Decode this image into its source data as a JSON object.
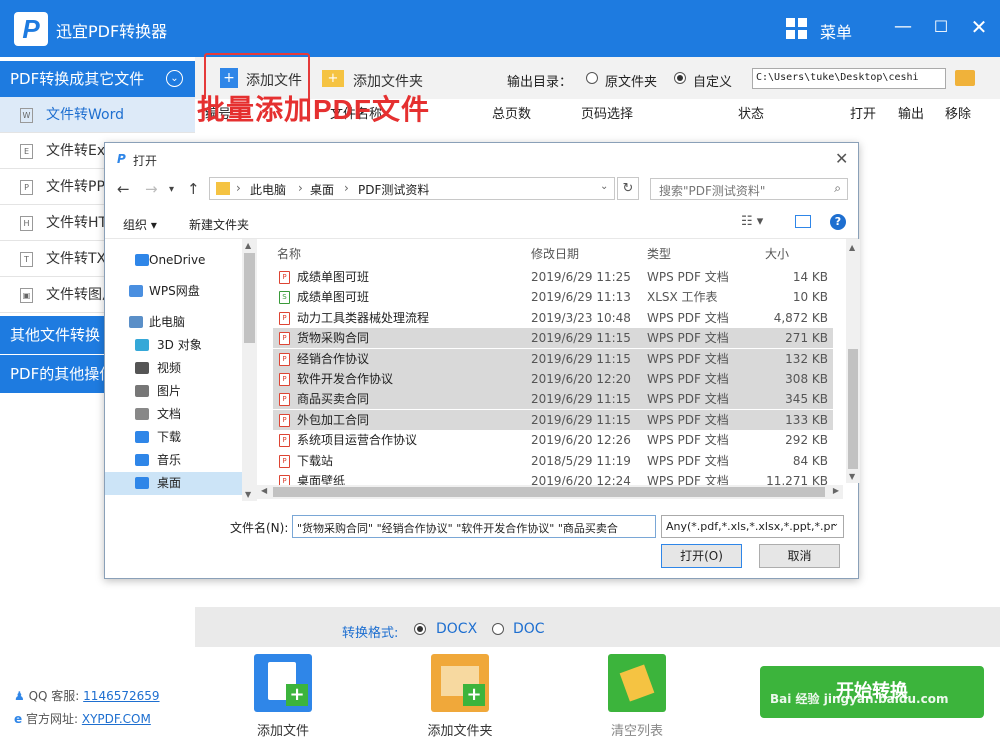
{
  "app": {
    "title": "迅宜PDF转换器",
    "logo_letter": "P",
    "menu_label": "菜单"
  },
  "sidebar": {
    "group1": "PDF转换成其它文件",
    "items": [
      {
        "label": "文件转Word",
        "icon": "W"
      },
      {
        "label": "文件转Exc",
        "icon": "E"
      },
      {
        "label": "文件转PP",
        "icon": "P"
      },
      {
        "label": "文件转HT",
        "icon": "H"
      },
      {
        "label": "文件转TX",
        "icon": "T"
      },
      {
        "label": "文件转图片",
        "icon": "img"
      }
    ],
    "group2": "其他文件转换",
    "group3": "PDF的其他操作"
  },
  "toolbar": {
    "add_file": "添加文件",
    "add_folder": "添加文件夹",
    "output_label": "输出目录：",
    "radio_source": "原文件夹",
    "radio_custom": "自定义",
    "output_path": "C:\\Users\\tuke\\Desktop\\ceshi"
  },
  "table_header": [
    "编号",
    "文件名称",
    "总页数",
    "页码选择",
    "状态",
    "打开",
    "输出",
    "移除"
  ],
  "dialog": {
    "title": "打开",
    "breadcrumb": [
      "此电脑",
      "桌面",
      "PDF测试资料"
    ],
    "search_placeholder": "搜索\"PDF测试资料\"",
    "organize": "组织 ▾",
    "new_folder": "新建文件夹",
    "nav": [
      {
        "label": "OneDrive",
        "color": "#2f86e8"
      },
      {
        "label": "WPS网盘",
        "color": "#4a8fe0"
      },
      {
        "label": "此电脑",
        "color": "#5a8fc8"
      },
      {
        "label": "3D 对象",
        "color": "#35a8d8"
      },
      {
        "label": "视频",
        "color": "#555555"
      },
      {
        "label": "图片",
        "color": "#777777"
      },
      {
        "label": "文档",
        "color": "#888888"
      },
      {
        "label": "下载",
        "color": "#2f86e8"
      },
      {
        "label": "音乐",
        "color": "#2f86e8"
      },
      {
        "label": "桌面",
        "color": "#2f86e8"
      }
    ],
    "columns": [
      "名称",
      "修改日期",
      "类型",
      "大小"
    ],
    "files": [
      {
        "name": "成绩单图可班",
        "date": "2019/6/29 11:25",
        "type": "WPS PDF 文档",
        "size": "14 KB",
        "sel": false,
        "kind": "pdf"
      },
      {
        "name": "成绩单图可班",
        "date": "2019/6/29 11:13",
        "type": "XLSX 工作表",
        "size": "10 KB",
        "sel": false,
        "kind": "xlsx"
      },
      {
        "name": "动力工具类器械处理流程",
        "date": "2019/3/23 10:48",
        "type": "WPS PDF 文档",
        "size": "4,872 KB",
        "sel": false,
        "kind": "pdf"
      },
      {
        "name": "货物采购合同",
        "date": "2019/6/29 11:15",
        "type": "WPS PDF 文档",
        "size": "271 KB",
        "sel": true,
        "kind": "pdf"
      },
      {
        "name": "经销合作协议",
        "date": "2019/6/29 11:15",
        "type": "WPS PDF 文档",
        "size": "132 KB",
        "sel": true,
        "kind": "pdf"
      },
      {
        "name": "软件开发合作协议",
        "date": "2019/6/20 12:20",
        "type": "WPS PDF 文档",
        "size": "308 KB",
        "sel": true,
        "kind": "pdf"
      },
      {
        "name": "商品买卖合同",
        "date": "2019/6/29 11:15",
        "type": "WPS PDF 文档",
        "size": "345 KB",
        "sel": true,
        "kind": "pdf"
      },
      {
        "name": "外包加工合同",
        "date": "2019/6/29 11:15",
        "type": "WPS PDF 文档",
        "size": "133 KB",
        "sel": true,
        "kind": "pdf"
      },
      {
        "name": "系统项目运营合作协议",
        "date": "2019/6/20 12:26",
        "type": "WPS PDF 文档",
        "size": "292 KB",
        "sel": false,
        "kind": "pdf"
      },
      {
        "name": "下载站",
        "date": "2018/5/29 11:19",
        "type": "WPS PDF 文档",
        "size": "84 KB",
        "sel": false,
        "kind": "pdf"
      },
      {
        "name": "桌面壁纸",
        "date": "2019/6/20 12:24",
        "type": "WPS PDF 文档",
        "size": "11,271 KB",
        "sel": false,
        "kind": "pdf"
      }
    ],
    "filename_label": "文件名(N):",
    "filename_value": "\"货物采购合同\" \"经销合作协议\" \"软件开发合作协议\" \"商品买卖合",
    "filetype_value": "Any(*.pdf,*.xls,*.xlsx,*.ppt,*.pr",
    "open_btn": "打开(O)",
    "cancel_btn": "取消"
  },
  "overlay_caption": "批量添加PDF文件",
  "format": {
    "label": "转换格式:",
    "opt1": "DOCX",
    "opt2": "DOC"
  },
  "bottom": {
    "add_file": "添加文件",
    "add_folder": "添加文件夹",
    "clear": "清空列表",
    "start": "开始转换"
  },
  "footer": {
    "qq_label": "QQ 客服:",
    "qq": "1146572659",
    "web_label": "官方网址:",
    "web": "XYPDF.COM"
  },
  "watermark": "Bai 经验 jingyan.baidu.com",
  "colors": {
    "brand": "#1e7be0",
    "highlight": "#e53a3a",
    "start": "#3cb43c"
  }
}
